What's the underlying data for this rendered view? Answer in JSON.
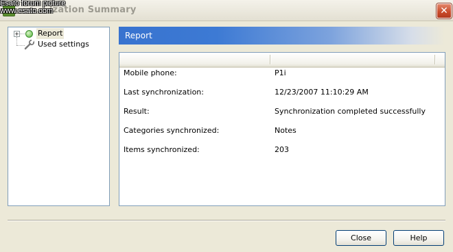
{
  "window": {
    "title": "Synchronization Summary",
    "title_visible_part": "ization Summary",
    "close_glyph": "✕"
  },
  "watermark": {
    "line1": "Esato forum picture",
    "line2": "www.esato.com"
  },
  "tree": {
    "items": [
      {
        "label": "Report",
        "icon": "report-icon",
        "selected": true,
        "expandable": true
      },
      {
        "label": "Used settings",
        "icon": "wrench-icon",
        "selected": false,
        "expandable": false
      }
    ]
  },
  "banner": {
    "title": "Report"
  },
  "details": {
    "rows": [
      {
        "key": "Mobile phone:",
        "value": "P1i"
      },
      {
        "key": "Last synchronization:",
        "value": "12/23/2007 11:10:29 AM"
      },
      {
        "key": "Result:",
        "value": "Synchronization completed successfully"
      },
      {
        "key": "Categories synchronized:",
        "value": "Notes"
      },
      {
        "key": "Items synchronized:",
        "value": "203"
      }
    ]
  },
  "buttons": {
    "close": "Close",
    "help": "Help"
  },
  "colors": {
    "banner_start": "#3873cf",
    "panel_border": "#7f9db9",
    "window_bg": "#ece9d8"
  }
}
